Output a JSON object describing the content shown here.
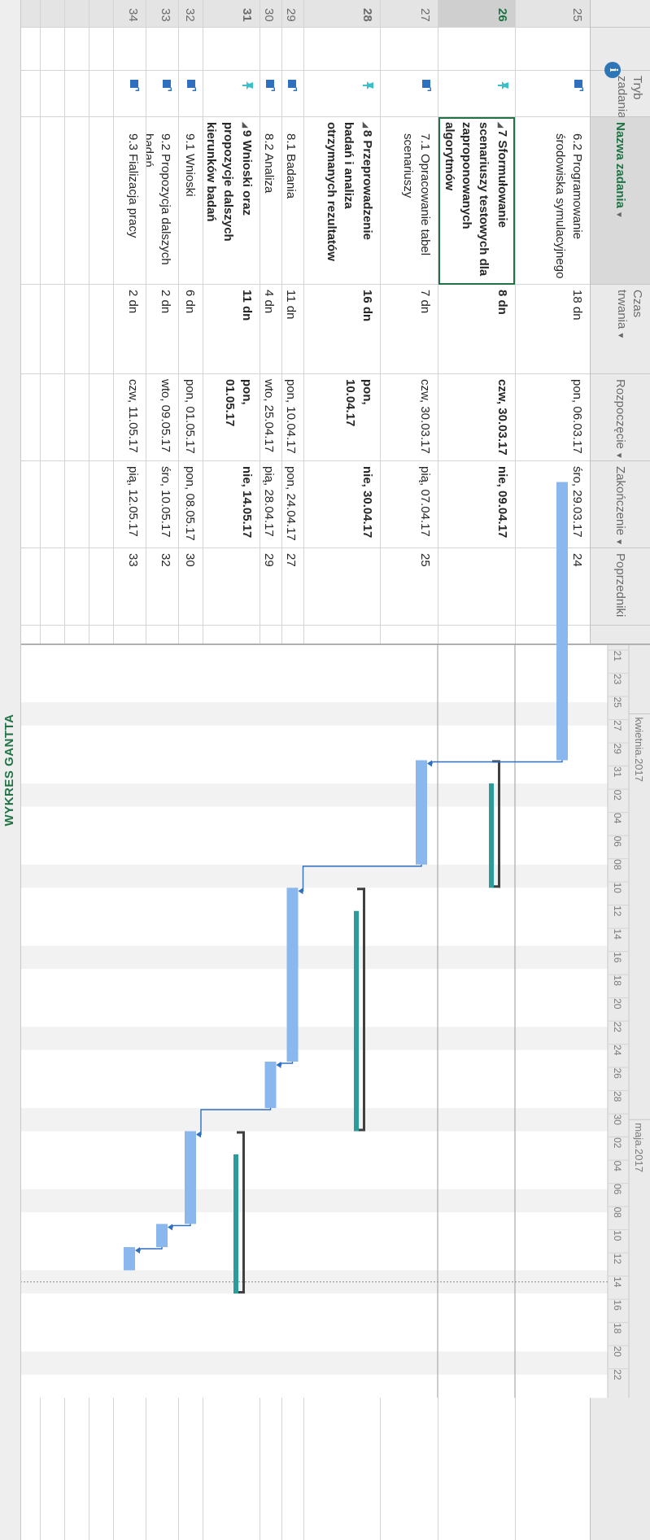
{
  "view_label": "WYKRES GANTTA",
  "columns": {
    "info": "i",
    "mode": "Tryb zadania",
    "name": "Nazwa zadania",
    "duration": "Czas trwania",
    "start": "Rozpoczęcie",
    "finish": "Zakończenie",
    "predecessors": "Poprzedniki"
  },
  "timescale": {
    "months": [
      "kwietnia.2017",
      "maja.2017"
    ],
    "days": [
      "21",
      "23",
      "25",
      "27",
      "29",
      "31",
      "02",
      "04",
      "06",
      "08",
      "10",
      "12",
      "14",
      "16",
      "18",
      "20",
      "22",
      "24",
      "26",
      "28",
      "30",
      "02",
      "04",
      "06",
      "08",
      "10",
      "12",
      "14",
      "16",
      "18",
      "20",
      "22"
    ]
  },
  "colors": {
    "task_bar": "#8ab8ee",
    "summary_bar": "#2a9d9a",
    "accent": "#217346",
    "link": "#2e6fc0"
  },
  "tasks": [
    {
      "id": "25",
      "mode": "auto",
      "name": "6.2 Programowanie środowiska symulacyjnego",
      "duration": "18 dn",
      "start": "pon, 06.03.17",
      "finish": "śro, 29.03.17",
      "pred": "24",
      "summary": false,
      "selected": false
    },
    {
      "id": "26",
      "mode": "manual",
      "name": "7 Sformułowanie scenariuszy testowych dla zaproponowanych algorytmów",
      "duration": "8 dn",
      "start": "czw, 30.03.17",
      "finish": "nie, 09.04.17",
      "pred": "",
      "summary": true,
      "selected": true
    },
    {
      "id": "27",
      "mode": "auto",
      "name": "7.1 Opracowanie tabel scenariuszy",
      "duration": "7 dn",
      "start": "czw, 30.03.17",
      "finish": "pią, 07.04.17",
      "pred": "25",
      "summary": false,
      "selected": false
    },
    {
      "id": "28",
      "mode": "manual",
      "name": "8 Przeprowadzenie badań i analiza otrzymanych rezultatów",
      "duration": "16 dn",
      "start": "pon, 10.04.17",
      "finish": "nie, 30.04.17",
      "pred": "",
      "summary": true,
      "selected": false
    },
    {
      "id": "29",
      "mode": "auto",
      "name": "8.1 Badania",
      "duration": "11 dn",
      "start": "pon, 10.04.17",
      "finish": "pon, 24.04.17",
      "pred": "27",
      "summary": false,
      "selected": false
    },
    {
      "id": "30",
      "mode": "auto",
      "name": "8.2 Analiza",
      "duration": "4 dn",
      "start": "wto, 25.04.17",
      "finish": "pią, 28.04.17",
      "pred": "29",
      "summary": false,
      "selected": false
    },
    {
      "id": "31",
      "mode": "manual",
      "name": "9 Wnioski oraz propozycje dalszych kierunków badań",
      "duration": "11 dn",
      "start": "pon, 01.05.17",
      "finish": "nie, 14.05.17",
      "pred": "",
      "summary": true,
      "selected": false
    },
    {
      "id": "32",
      "mode": "auto",
      "name": "9.1 Wnioski",
      "duration": "6 dn",
      "start": "pon, 01.05.17",
      "finish": "pon, 08.05.17",
      "pred": "30",
      "summary": false,
      "selected": false
    },
    {
      "id": "33",
      "mode": "auto",
      "name": "9.2 Propozycja dalszych badań",
      "duration": "2 dn",
      "start": "wto, 09.05.17",
      "finish": "śro, 10.05.17",
      "pred": "32",
      "summary": false,
      "selected": false
    },
    {
      "id": "34",
      "mode": "auto",
      "name": "9.3 Fializacja pracy",
      "duration": "2 dn",
      "start": "czw, 11.05.17",
      "finish": "pią, 12.05.17",
      "pred": "33",
      "summary": false,
      "selected": false
    },
    {
      "id": "",
      "mode": "",
      "name": "",
      "duration": "",
      "start": "",
      "finish": "",
      "pred": "",
      "summary": false,
      "selected": false
    },
    {
      "id": "",
      "mode": "",
      "name": "",
      "duration": "",
      "start": "",
      "finish": "",
      "pred": "",
      "summary": false,
      "selected": false
    },
    {
      "id": "",
      "mode": "",
      "name": "",
      "duration": "",
      "start": "",
      "finish": "",
      "pred": "",
      "summary": false,
      "selected": false
    },
    {
      "id": "",
      "mode": "",
      "name": "",
      "duration": "",
      "start": "",
      "finish": "",
      "pred": "",
      "summary": false,
      "selected": false
    },
    {
      "id": "",
      "mode": "",
      "name": "",
      "duration": "",
      "start": "",
      "finish": "",
      "pred": "",
      "summary": false,
      "selected": false
    },
    {
      "id": "",
      "mode": "",
      "name": "",
      "duration": "",
      "start": "",
      "finish": "",
      "pred": "",
      "summary": false,
      "selected": false
    }
  ]
}
